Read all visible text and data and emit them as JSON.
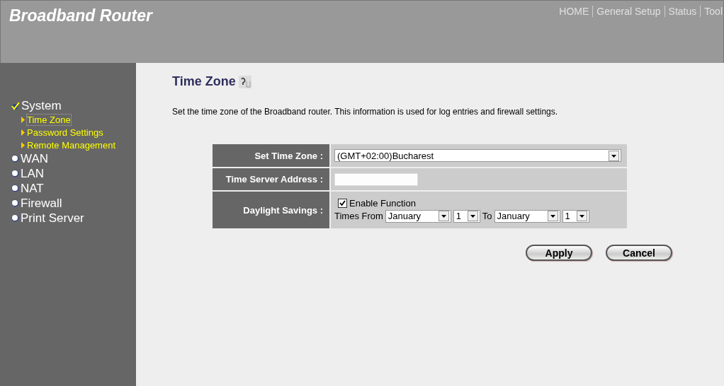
{
  "header": {
    "title": "Broadband Router",
    "nav": [
      "HOME",
      "General Setup",
      "Status",
      "Tool"
    ]
  },
  "sidebar": {
    "items": [
      {
        "label": "System",
        "expanded": true,
        "children": [
          {
            "label": "Time Zone",
            "selected": true
          },
          {
            "label": "Password Settings",
            "selected": false
          },
          {
            "label": "Remote Management",
            "selected": false
          }
        ]
      },
      {
        "label": "WAN",
        "expanded": false
      },
      {
        "label": "LAN",
        "expanded": false
      },
      {
        "label": "NAT",
        "expanded": false
      },
      {
        "label": "Firewall",
        "expanded": false
      },
      {
        "label": "Print Server",
        "expanded": false
      }
    ]
  },
  "page": {
    "title": "Time Zone",
    "description": "Set the time zone of the Broadband router. This information is used for log entries and firewall settings."
  },
  "form": {
    "time_zone": {
      "label": "Set Time Zone :",
      "value": "(GMT+02:00)Bucharest"
    },
    "time_server": {
      "label": "Time Server Address :"
    },
    "daylight": {
      "label": "Daylight Savings :",
      "enable": {
        "label": "Enable Function",
        "checked": true
      },
      "from_label": "Times From",
      "from_month": "January",
      "from_day": "1",
      "to_label": "To",
      "to_month": "January",
      "to_day": "1"
    }
  },
  "buttons": [
    "Apply",
    "Cancel"
  ]
}
